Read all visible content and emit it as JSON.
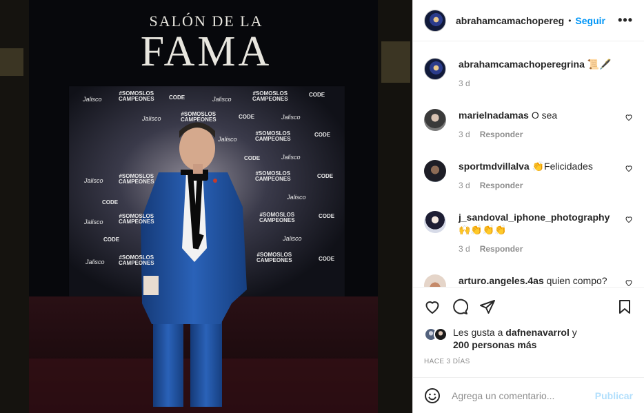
{
  "photo": {
    "title_line1": "SALÓN DE LA",
    "title_line2": "FAMA",
    "logos": {
      "jalisco": "Jalisco",
      "code": "CODE",
      "somos": "#SOMOSLOS",
      "campeones": "CAMPEONES"
    }
  },
  "header": {
    "username": "abrahamcamachopereg",
    "separator": "•",
    "follow_label": "Seguir",
    "more_label": "•••"
  },
  "caption": {
    "username": "abrahamcamachoperegrina",
    "text": "📜🖋️",
    "time": "3 d"
  },
  "comments": [
    {
      "username": "marielnadamas",
      "text": "O sea",
      "time": "3 d",
      "reply": "Responder"
    },
    {
      "username": "sportmdvillalva",
      "text": "👏Felicidades",
      "time": "3 d",
      "reply": "Responder"
    },
    {
      "username": "j_sandoval_iphone_photography",
      "text": "🙌👏👏👏",
      "time": "3 d",
      "reply": "Responder"
    },
    {
      "username": "arturo.angeles.4as",
      "text": "quien compo?",
      "time": "",
      "reply": ""
    }
  ],
  "likes": {
    "prefix": "Les gusta a",
    "user": "dafnenavarrol",
    "conj": "y",
    "others": "200 personas más"
  },
  "timestamp": "HACE 3 DÍAS",
  "composer": {
    "placeholder": "Agrega un comentario...",
    "post_label": "Publicar"
  },
  "icons": [
    "heart-icon",
    "comment-icon",
    "share-icon",
    "bookmark-icon",
    "emoji-icon",
    "more-icon",
    "small-heart-icon"
  ],
  "colors": {
    "link_blue": "#0095f6",
    "post_disabled": "#b2dffc",
    "meta_gray": "#8e8e8e",
    "suit_blue": "#1f4f9a"
  }
}
